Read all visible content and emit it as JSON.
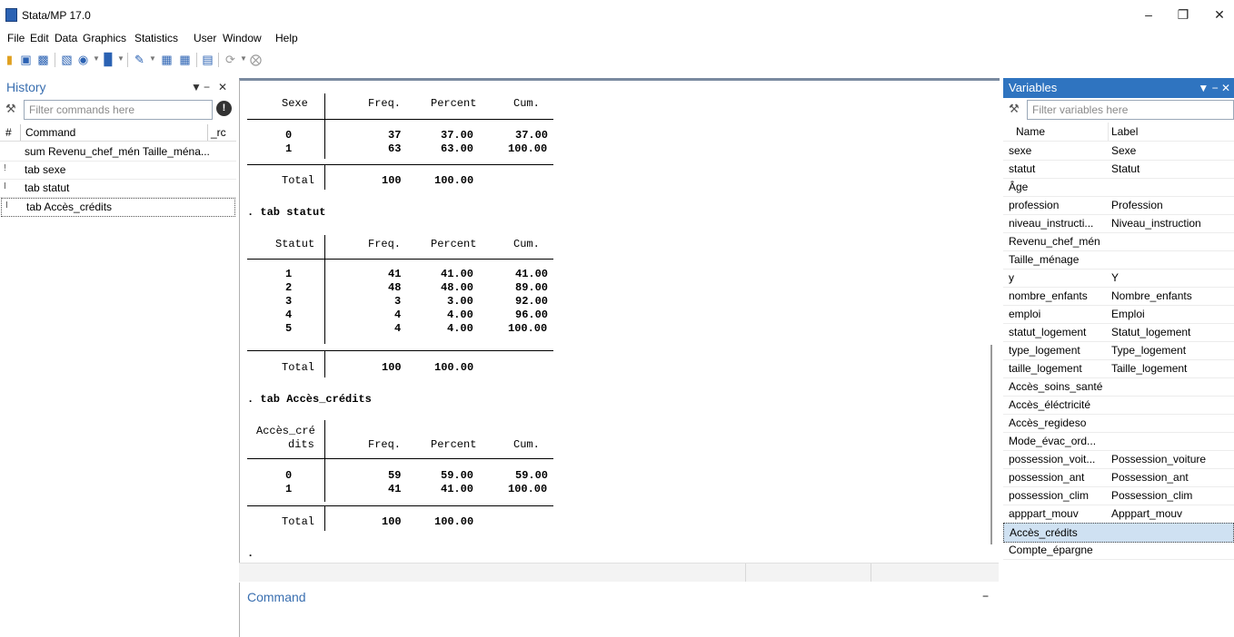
{
  "window": {
    "title": "Stata/MP 17.0"
  },
  "menu": [
    "File",
    "Edit",
    "Data",
    "Graphics",
    "Statistics",
    "User",
    "Window",
    "Help"
  ],
  "history": {
    "title": "History",
    "filter_placeholder": "Filter commands here",
    "col_hash": "#",
    "col_command": "Command",
    "col_rc": "_rc",
    "items": [
      {
        "num": "",
        "cmd": "sum Revenu_chef_mén Taille_ména..."
      },
      {
        "num": "!",
        "cmd": "tab sexe"
      },
      {
        "num": "I",
        "cmd": "tab statut"
      },
      {
        "num": "I",
        "cmd": "tab Accès_crédits"
      }
    ]
  },
  "results": {
    "t1": {
      "header_label": "Sexe",
      "h_freq": "Freq.",
      "h_pct": "Percent",
      "h_cum": "Cum.",
      "rows": [
        {
          "k": "0",
          "f": "37",
          "p": "37.00",
          "c": "37.00"
        },
        {
          "k": "1",
          "f": "63",
          "p": "63.00",
          "c": "100.00"
        }
      ],
      "total": {
        "k": "Total",
        "f": "100",
        "p": "100.00"
      }
    },
    "cmd2": ". tab statut",
    "t2": {
      "header_label": "Statut",
      "h_freq": "Freq.",
      "h_pct": "Percent",
      "h_cum": "Cum.",
      "rows": [
        {
          "k": "1",
          "f": "41",
          "p": "41.00",
          "c": "41.00"
        },
        {
          "k": "2",
          "f": "48",
          "p": "48.00",
          "c": "89.00"
        },
        {
          "k": "3",
          "f": "3",
          "p": "3.00",
          "c": "92.00"
        },
        {
          "k": "4",
          "f": "4",
          "p": "4.00",
          "c": "96.00"
        },
        {
          "k": "5",
          "f": "4",
          "p": "4.00",
          "c": "100.00"
        }
      ],
      "total": {
        "k": "Total",
        "f": "100",
        "p": "100.00"
      }
    },
    "cmd3": ". tab Accès_crédits",
    "t3": {
      "header_label1": "Accès_cré",
      "header_label2": "dits",
      "h_freq": "Freq.",
      "h_pct": "Percent",
      "h_cum": "Cum.",
      "rows": [
        {
          "k": "0",
          "f": "59",
          "p": "59.00",
          "c": "59.00"
        },
        {
          "k": "1",
          "f": "41",
          "p": "41.00",
          "c": "100.00"
        }
      ],
      "total": {
        "k": "Total",
        "f": "100",
        "p": "100.00"
      }
    },
    "prompt": "."
  },
  "command": {
    "title": "Command"
  },
  "variables": {
    "title": "Variables",
    "filter_placeholder": "Filter variables here",
    "col_name": "Name",
    "col_label": "Label",
    "rows": [
      {
        "name": "sexe",
        "label": "Sexe"
      },
      {
        "name": "statut",
        "label": "Statut"
      },
      {
        "name": "Âge",
        "label": ""
      },
      {
        "name": "profession",
        "label": "Profession"
      },
      {
        "name": "niveau_instructi...",
        "label": "Niveau_instruction"
      },
      {
        "name": "Revenu_chef_mén",
        "label": ""
      },
      {
        "name": "Taille_ménage",
        "label": ""
      },
      {
        "name": "y",
        "label": "Y"
      },
      {
        "name": "nombre_enfants",
        "label": "Nombre_enfants"
      },
      {
        "name": "emploi",
        "label": "Emploi"
      },
      {
        "name": "statut_logement",
        "label": "Statut_logement"
      },
      {
        "name": "type_logement",
        "label": "Type_logement"
      },
      {
        "name": "taille_logement",
        "label": "Taille_logement"
      },
      {
        "name": "Accès_soins_santé",
        "label": ""
      },
      {
        "name": "Accès_éléctricité",
        "label": ""
      },
      {
        "name": "Accès_regideso",
        "label": ""
      },
      {
        "name": "Mode_évac_ord...",
        "label": ""
      },
      {
        "name": "possession_voit...",
        "label": "Possession_voiture"
      },
      {
        "name": "possession_ant",
        "label": "Possession_ant"
      },
      {
        "name": "possession_clim",
        "label": "Possession_clim"
      },
      {
        "name": "apppart_mouv",
        "label": "Apppart_mouv"
      },
      {
        "name": "Accès_crédits",
        "label": ""
      },
      {
        "name": "Compte_épargne",
        "label": ""
      }
    ]
  },
  "colors": {
    "accent": "#2f74c0",
    "panel_title": "#3a6fb0",
    "selected_row": "#cfe1f2"
  }
}
